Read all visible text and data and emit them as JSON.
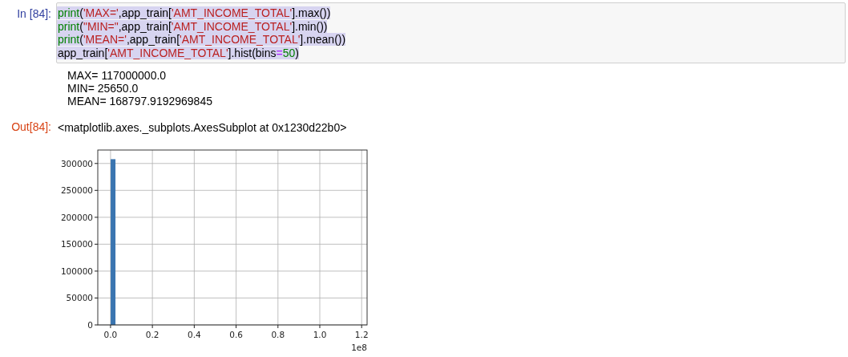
{
  "input_cell": {
    "prompt": "In [84]:",
    "selected_text": true,
    "lines": [
      [
        {
          "kind": "builtin",
          "text": "print"
        },
        {
          "kind": "plain",
          "text": "("
        },
        {
          "kind": "string",
          "text": "'MAX='"
        },
        {
          "kind": "plain",
          "text": ",app_train["
        },
        {
          "kind": "string",
          "text": "'AMT_INCOME_TOTAL'"
        },
        {
          "kind": "plain",
          "text": "].max())"
        }
      ],
      [
        {
          "kind": "builtin",
          "text": "print"
        },
        {
          "kind": "plain",
          "text": "("
        },
        {
          "kind": "string",
          "text": "\"MIN=\""
        },
        {
          "kind": "plain",
          "text": ",app_train["
        },
        {
          "kind": "string",
          "text": "'AMT_INCOME_TOTAL'"
        },
        {
          "kind": "plain",
          "text": "].min())"
        }
      ],
      [
        {
          "kind": "builtin",
          "text": "print"
        },
        {
          "kind": "plain",
          "text": "("
        },
        {
          "kind": "string",
          "text": "'MEAN='"
        },
        {
          "kind": "plain",
          "text": ",app_train["
        },
        {
          "kind": "string",
          "text": "'AMT_INCOME_TOTAL'"
        },
        {
          "kind": "plain",
          "text": "].mean())"
        }
      ],
      [
        {
          "kind": "plain",
          "text": "app_train["
        },
        {
          "kind": "string",
          "text": "'AMT_INCOME_TOTAL'"
        },
        {
          "kind": "plain",
          "text": "].hist(bins"
        },
        {
          "kind": "operator",
          "text": "="
        },
        {
          "kind": "number",
          "text": "50"
        },
        {
          "kind": "plain",
          "text": ")"
        }
      ]
    ]
  },
  "stream_output": [
    "MAX= 117000000.0",
    "MIN= 25650.0",
    "MEAN= 168797.9192969845"
  ],
  "output_cell": {
    "prompt": "Out[84]:",
    "text": "<matplotlib.axes._subplots.AxesSubplot at 0x1230d22b0>",
    "chart_data": {
      "type": "bar",
      "grid": true,
      "annotations": [
        {
          "text": "1e8"
        }
      ],
      "x": [
        0.012,
        0.035,
        0.059,
        0.082,
        0.106,
        0.129,
        0.152,
        0.176,
        0.199,
        0.223,
        0.246,
        0.269,
        0.293,
        0.316,
        0.34,
        0.363,
        0.386,
        0.41,
        0.433,
        0.457,
        0.48,
        0.503,
        0.527,
        0.55,
        0.574,
        0.597,
        0.62,
        0.644,
        0.667,
        0.691,
        0.714,
        0.737,
        0.761,
        0.784,
        0.808,
        0.831,
        0.854,
        0.878,
        0.901,
        0.925,
        0.948,
        0.971,
        0.995,
        1.018,
        1.042,
        1.065,
        1.088,
        1.112,
        1.135,
        1.159
      ],
      "values": [
        308000,
        0,
        0,
        0,
        0,
        0,
        0,
        0,
        0,
        0,
        0,
        0,
        0,
        0,
        0,
        0,
        0,
        0,
        0,
        0,
        0,
        0,
        0,
        0,
        0,
        0,
        0,
        0,
        0,
        0,
        0,
        0,
        0,
        0,
        0,
        0,
        0,
        0,
        0,
        0,
        0,
        0,
        0,
        0,
        0,
        0,
        0,
        0,
        0,
        0
      ],
      "xlim": [
        -0.061,
        1.226
      ],
      "ylim": [
        0,
        325000
      ],
      "xticks": [
        {
          "value": 0,
          "label": "0.0"
        },
        {
          "value": 0.2,
          "label": "0.2"
        },
        {
          "value": 0.4,
          "label": "0.4"
        },
        {
          "value": 0.6,
          "label": "0.6"
        },
        {
          "value": 0.8,
          "label": "0.8"
        },
        {
          "value": 1.0,
          "label": "1.0"
        },
        {
          "value": 1.2,
          "label": "1.2"
        }
      ],
      "yticks": [
        0,
        50000,
        100000,
        150000,
        200000,
        250000,
        300000
      ]
    }
  }
}
